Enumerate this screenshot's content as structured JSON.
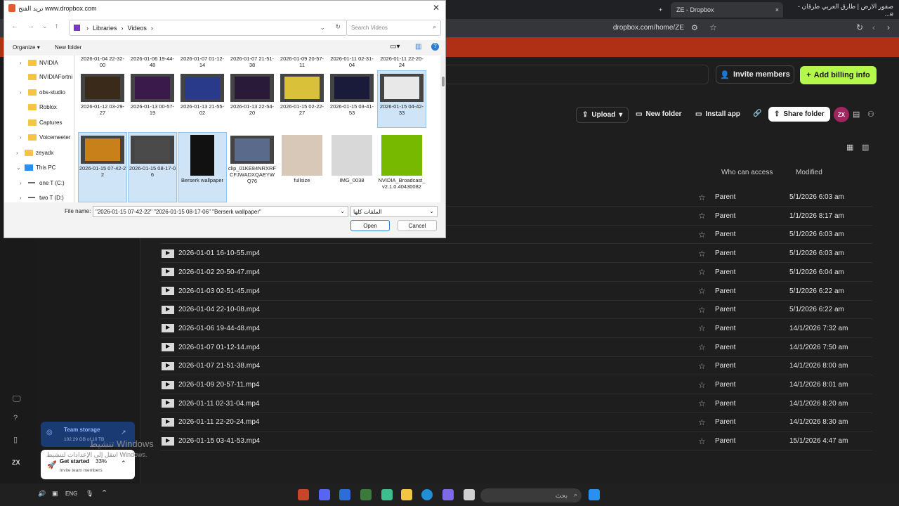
{
  "browser": {
    "tabs": [
      {
        "label": "ZE - Dropbox",
        "active": true
      },
      {
        "label": "صفور الارض | طارق العربي طرقان - e...",
        "active": false
      }
    ],
    "url": "dropbox.com/home/ZE"
  },
  "dropbox": {
    "invite_label": "Invite members",
    "billing_label": "Add billing info",
    "toolbar": {
      "upload": "Upload",
      "new_folder": "New folder",
      "install_app": "Install app",
      "share_folder": "Share folder",
      "avatar": "ZX"
    },
    "columns": {
      "access": "Who can access",
      "modified": "Modified"
    },
    "rows": [
      {
        "name": "",
        "access": "Parent",
        "modified": "5/1/2026 6:03 am"
      },
      {
        "name": "",
        "access": "Parent",
        "modified": "1/1/2026 8:17 am"
      },
      {
        "name": "",
        "access": "Parent",
        "modified": "5/1/2026 6:03 am"
      },
      {
        "name": "2026-01-01 16-10-55.mp4",
        "access": "Parent",
        "modified": "5/1/2026 6:03 am"
      },
      {
        "name": "2026-01-02 20-50-47.mp4",
        "access": "Parent",
        "modified": "5/1/2026 6:04 am"
      },
      {
        "name": "2026-01-03 02-51-45.mp4",
        "access": "Parent",
        "modified": "5/1/2026 6:22 am"
      },
      {
        "name": "2026-01-04 22-10-08.mp4",
        "access": "Parent",
        "modified": "5/1/2026 6:22 am"
      },
      {
        "name": "2026-01-06 19-44-48.mp4",
        "access": "Parent",
        "modified": "14/1/2026 7:32 am"
      },
      {
        "name": "2026-01-07 01-12-14.mp4",
        "access": "Parent",
        "modified": "14/1/2026 7:50 am"
      },
      {
        "name": "2026-01-07 21-51-38.mp4",
        "access": "Parent",
        "modified": "14/1/2026 8:00 am"
      },
      {
        "name": "2026-01-09 20-57-11.mp4",
        "access": "Parent",
        "modified": "14/1/2026 8:01 am"
      },
      {
        "name": "2026-01-11 02-31-04.mp4",
        "access": "Parent",
        "modified": "14/1/2026 8:20 am"
      },
      {
        "name": "2026-01-11 22-20-24.mp4",
        "access": "Parent",
        "modified": "14/1/2026 8:30 am"
      },
      {
        "name": "2026-01-15 03-41-53.mp4",
        "access": "Parent",
        "modified": "15/1/2026 4:47 am"
      }
    ],
    "storage": {
      "title": "Team storage",
      "usage": "102.29 GB of 10 TB"
    },
    "getstarted": {
      "title": "Get started",
      "percent": "33%",
      "subtitle": "Invite team members"
    },
    "watermark": {
      "line1": "تنشيط Windows",
      "line2": "انتقل إلى الإعدادات لتنشيط Windows."
    }
  },
  "dialog": {
    "title": "تريد الفتح www.dropbox.com",
    "breadcrumb": [
      "Libraries",
      "Videos"
    ],
    "search_placeholder": "Search Videos",
    "organize": "Organize",
    "new_folder": "New folder",
    "tree": [
      "NVIDIA",
      "NVIDIAFortni",
      "obs-studio",
      "Roblox",
      "Captures",
      "Voicemeeter",
      "zeyadx",
      "This PC",
      "one T (C:)",
      "two T (D:)"
    ],
    "top_labels": [
      "2026-01-04 22-32-00",
      "2026-01-06 19-44-48",
      "2026-01-07 01-12-14",
      "2026-01-07 21-51-38",
      "2026-01-09 20-57-11",
      "2026-01-11 02-31-04",
      "2026-01-11 22-20-24"
    ],
    "row2": [
      "2026-01-12 03-29-27",
      "2026-01-13 00-57-19",
      "2026-01-13 21-55-02",
      "2026-01-13 22-54-20",
      "2026-01-15 02-22-27",
      "2026-01-15 03-41-53",
      "2026-01-15 04-42-33"
    ],
    "row3": [
      "2026-01-15 07-42-22",
      "2026-01-15 08-17-06",
      "Berserk wallpaper",
      "clip_01KE84NRXRFCFJWADXQAEYWQ76",
      "fullsize",
      "IMG_0038",
      "NVIDIA_Broadcast_v2.1.0.40430082"
    ],
    "filename_label": "File name:",
    "filename_value": "\"2026-01-15 07-42-22\" \"2026-01-15 08-17-06\" \"Berserk wallpaper\"",
    "filetype": "الملفات كلها",
    "open": "Open",
    "cancel": "Cancel"
  },
  "taskbar": {
    "lang": "ENG",
    "search": "بحث"
  }
}
